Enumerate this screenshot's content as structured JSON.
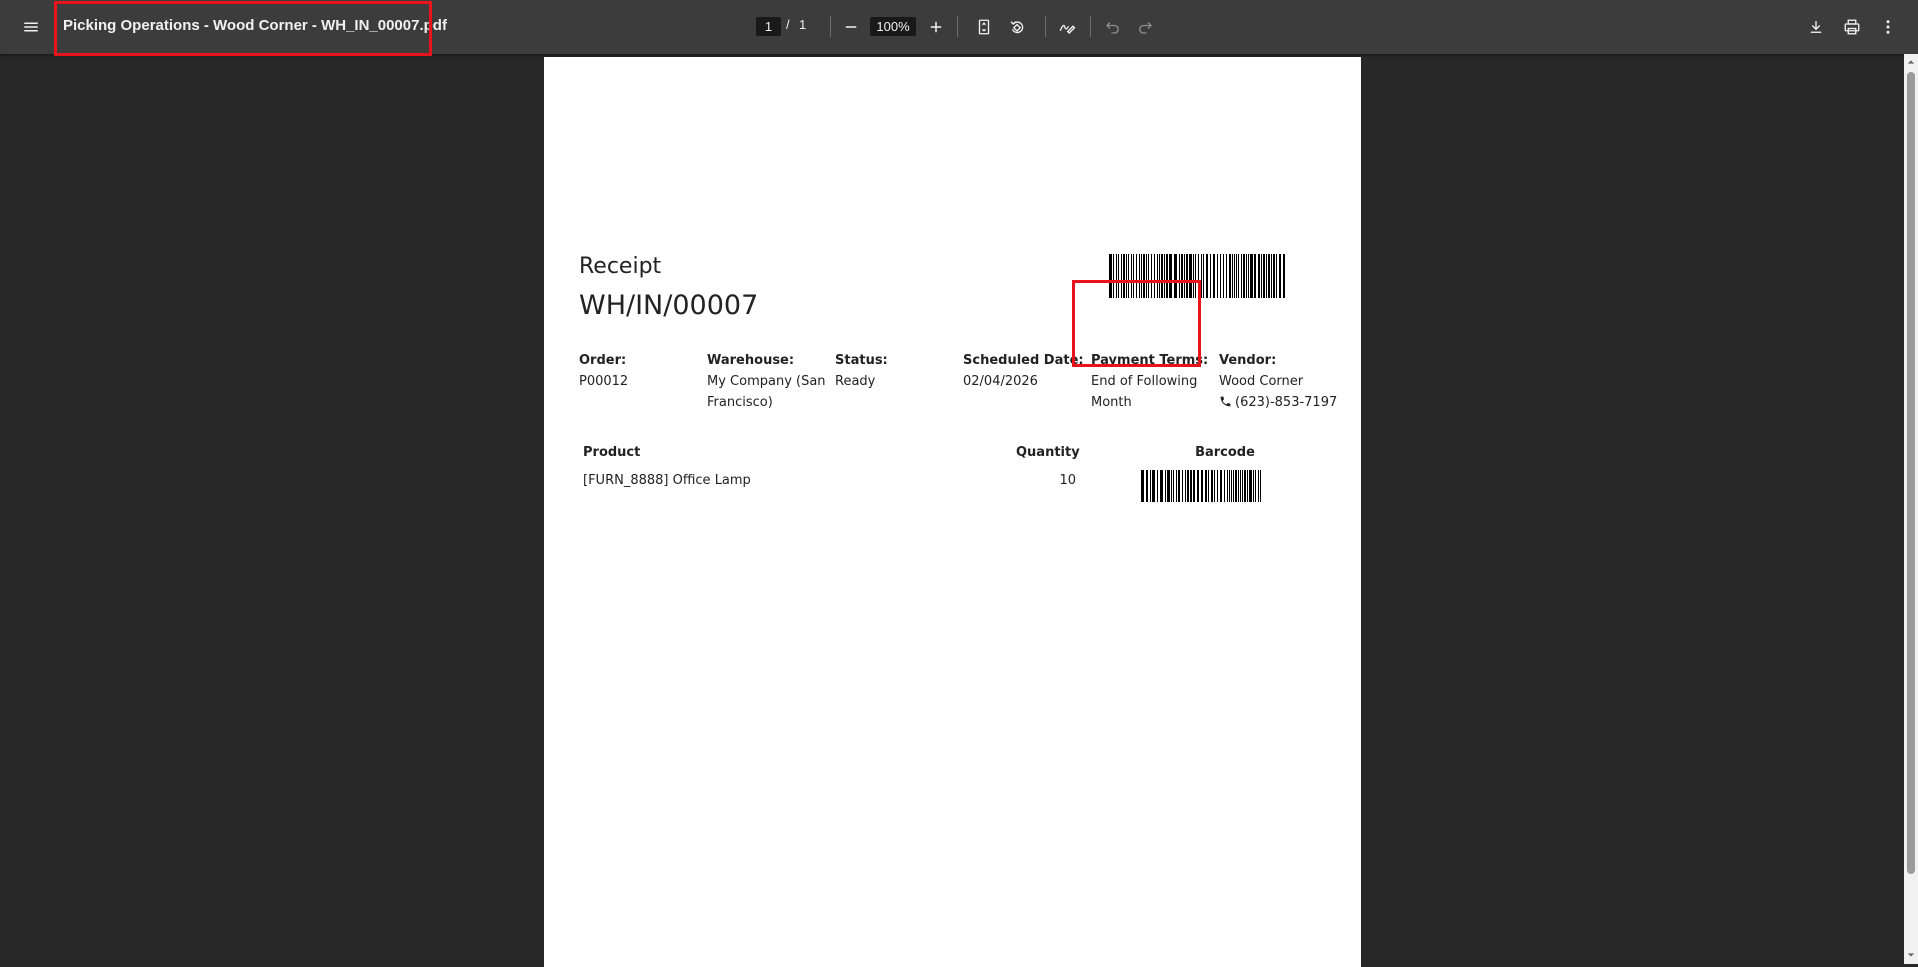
{
  "viewer": {
    "document_title": "Picking Operations - Wood Corner - WH_IN_00007.pdf",
    "current_page": "1",
    "page_separator": "/",
    "total_pages": "1",
    "zoom": "100%"
  },
  "document": {
    "doc_type": "Receipt",
    "reference": "WH/IN/00007",
    "info": {
      "order_label": "Order:",
      "order_value": "P00012",
      "warehouse_label": "Warehouse:",
      "warehouse_value_line1": "My Company (San",
      "warehouse_value_line2": "Francisco)",
      "status_label": "Status:",
      "status_value": "Ready",
      "scheduled_label": "Scheduled Date:",
      "scheduled_value": "02/04/2026",
      "payment_label": "Payment Terms:",
      "payment_value_line1": "End of Following",
      "payment_value_line2": "Month",
      "vendor_label": "Vendor:",
      "vendor_value": "Wood Corner",
      "vendor_phone": "(623)-853-7197"
    },
    "table": {
      "headers": [
        "Product",
        "Quantity",
        "Barcode"
      ],
      "rows": [
        {
          "product": "[FURN_8888] Office Lamp",
          "quantity": "10"
        }
      ]
    }
  },
  "icons": [
    "menu-icon",
    "zoom-out-icon",
    "zoom-in-icon",
    "fit-page-icon",
    "rotate-icon",
    "annotate-icon",
    "undo-icon",
    "redo-icon",
    "download-icon",
    "print-icon",
    "more-options-icon",
    "phone-icon"
  ],
  "colors": {
    "toolbar": "#3c3c3c",
    "background": "#282828",
    "highlight": "#e8141c"
  }
}
